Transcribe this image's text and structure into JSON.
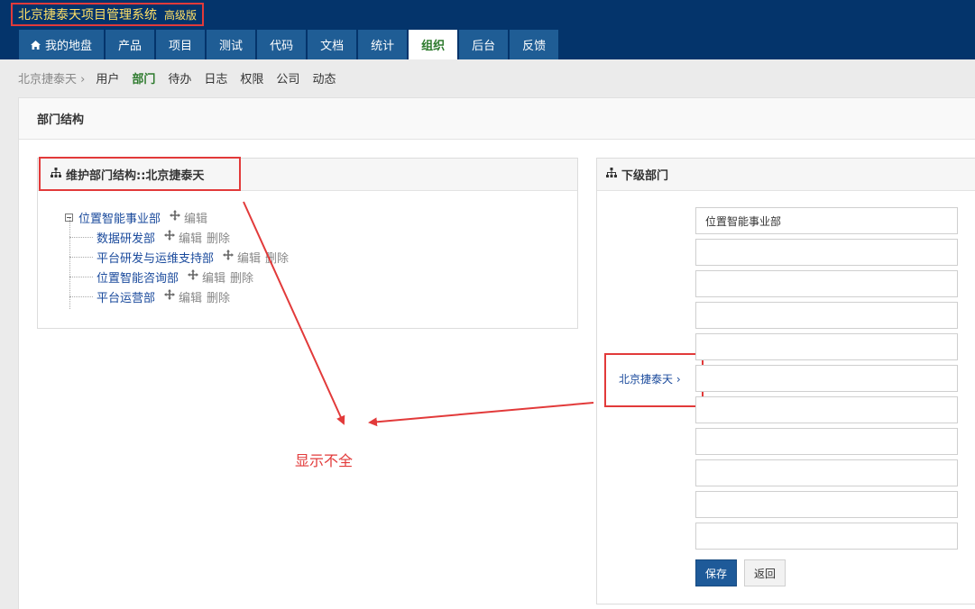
{
  "header": {
    "app_name": "北京捷泰天项目管理系统",
    "edition": "高级版"
  },
  "nav": {
    "items": [
      {
        "label": "我的地盘",
        "icon": "home-icon"
      },
      {
        "label": "产品"
      },
      {
        "label": "项目"
      },
      {
        "label": "测试"
      },
      {
        "label": "代码"
      },
      {
        "label": "文档"
      },
      {
        "label": "统计"
      },
      {
        "label": "组织",
        "active": true
      },
      {
        "label": "后台"
      },
      {
        "label": "反馈"
      }
    ]
  },
  "subnav": {
    "breadcrumb": "北京捷泰天 ›",
    "items": [
      "用户",
      "部门",
      "待办",
      "日志",
      "权限",
      "公司",
      "动态"
    ],
    "active": "部门"
  },
  "page": {
    "title": "部门结构"
  },
  "tree_panel": {
    "title": "维护部门结构::北京捷泰天",
    "root": {
      "label": "位置智能事业部",
      "actions": [
        "编辑"
      ]
    },
    "children": [
      {
        "label": "数据研发部",
        "actions": [
          "编辑",
          "删除"
        ]
      },
      {
        "label": "平台研发与运维支持部",
        "actions": [
          "编辑",
          "删除"
        ]
      },
      {
        "label": "位置智能咨询部",
        "actions": [
          "编辑",
          "删除"
        ]
      },
      {
        "label": "平台运营部",
        "actions": [
          "编辑",
          "删除"
        ]
      }
    ]
  },
  "child_panel": {
    "title": "下级部门",
    "parent_label": "北京捷泰天 ›",
    "inputs": [
      "位置智能事业部",
      "",
      "",
      "",
      "",
      "",
      "",
      "",
      "",
      "",
      ""
    ],
    "save_label": "保存",
    "back_label": "返回"
  },
  "annotation": {
    "text": "显示不全",
    "color": "#e23a3a"
  },
  "colors": {
    "header_bg": "#04346b",
    "nav_bg": "#1f5d95",
    "active_green": "#2d7a2d",
    "link_blue": "#1a4a9c",
    "brand_yellow": "#ffe066"
  }
}
